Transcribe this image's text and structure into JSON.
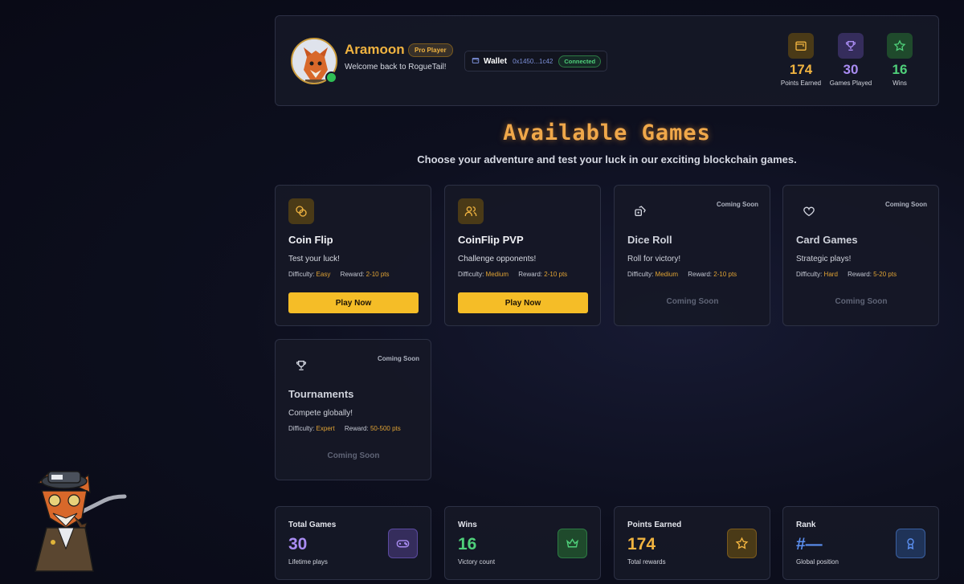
{
  "header": {
    "username": "Aramoon",
    "badge": "Pro Player",
    "welcome": "Welcome back to RogueTail!",
    "wallet": {
      "label": "Wallet",
      "address": "0x1450...1c42",
      "status": "Connected"
    },
    "stats": [
      {
        "value": "174",
        "label": "Points Earned",
        "icon": "wallet-icon",
        "color": "#f0b340"
      },
      {
        "value": "30",
        "label": "Games Played",
        "icon": "trophy-icon",
        "color": "#a98cf2"
      },
      {
        "value": "16",
        "label": "Wins",
        "icon": "star-icon",
        "color": "#4fd07a"
      }
    ]
  },
  "title": "Available Games",
  "subtitle": "Choose your adventure and test your luck in our exciting blockchain games.",
  "games": [
    {
      "name": "Coin Flip",
      "desc": "Test your luck!",
      "difficulty_label": "Difficulty:",
      "difficulty": "Easy",
      "reward_label": "Reward:",
      "reward": "2-10 pts",
      "button": "Play Now",
      "icon": "coins-icon"
    },
    {
      "name": "CoinFlip PVP",
      "desc": "Challenge opponents!",
      "difficulty_label": "Difficulty:",
      "difficulty": "Medium",
      "reward_label": "Reward:",
      "reward": "2-10 pts",
      "button": "Play Now",
      "icon": "users-icon"
    },
    {
      "name": "Dice Roll",
      "desc": "Roll for victory!",
      "difficulty_label": "Difficulty:",
      "difficulty": "Medium",
      "reward_label": "Reward:",
      "reward": "2-10 pts",
      "tag": "Coming Soon",
      "button": "Coming Soon",
      "icon": "dice-icon"
    },
    {
      "name": "Card Games",
      "desc": "Strategic plays!",
      "difficulty_label": "Difficulty:",
      "difficulty": "Hard",
      "reward_label": "Reward:",
      "reward": "5-20 pts",
      "tag": "Coming Soon",
      "button": "Coming Soon",
      "icon": "heart-icon"
    },
    {
      "name": "Tournaments",
      "desc": "Compete globally!",
      "difficulty_label": "Difficulty:",
      "difficulty": "Expert",
      "reward_label": "Reward:",
      "reward": "50-500 pts",
      "tag": "Coming Soon",
      "button": "Coming Soon",
      "icon": "trophy-icon"
    }
  ],
  "bottom_stats": [
    {
      "label": "Total Games",
      "value": "30",
      "sub": "Lifetime plays",
      "icon": "gamepad-icon",
      "color": "#a98cf2"
    },
    {
      "label": "Wins",
      "value": "16",
      "sub": "Victory count",
      "icon": "crown-icon",
      "color": "#4fd07a"
    },
    {
      "label": "Points Earned",
      "value": "174",
      "sub": "Total rewards",
      "icon": "star-icon",
      "color": "#f0b340"
    },
    {
      "label": "Rank",
      "value": "#—",
      "sub": "Global position",
      "icon": "award-icon",
      "color": "#5b8ff0"
    }
  ]
}
